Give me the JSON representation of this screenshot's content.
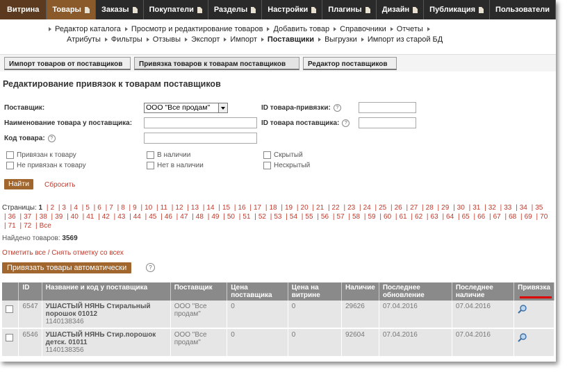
{
  "topnav": [
    {
      "label": "Витрина",
      "kind": "vitrina"
    },
    {
      "label": "Товары",
      "kind": "active"
    },
    {
      "label": "Заказы",
      "kind": "normal"
    },
    {
      "label": "Покупатели",
      "kind": "normal"
    },
    {
      "label": "Разделы",
      "kind": "normal"
    },
    {
      "label": "Настройки",
      "kind": "normal"
    },
    {
      "label": "Плагины",
      "kind": "normal"
    },
    {
      "label": "Дизайн",
      "kind": "normal"
    },
    {
      "label": "Публикация",
      "kind": "normal"
    },
    {
      "label": "Пользователи",
      "kind": "normal"
    }
  ],
  "submenu": {
    "row1": [
      "Редактор каталога",
      "Просмотр и редактирование товаров",
      "Добавить товар",
      "Справочники",
      "Отчеты"
    ],
    "row2": [
      "Атрибуты",
      "Фильтры",
      "Отзывы",
      "Экспорт",
      "Импорт",
      "Поставщики",
      "Выгрузки",
      "Импорт из старой БД"
    ],
    "active": "Поставщики"
  },
  "innertabs": [
    "Импорт товаров от поставщиков",
    "Привязка товаров к товарам поставщиков",
    "Редактор поставщиков"
  ],
  "page_title": "Редактирование привязок к товарам поставщиков",
  "form": {
    "supplier_label": "Поставщик:",
    "supplier_value": "ООО \"Все продам\"",
    "name_label": "Наименование товара у поставщика:",
    "code_label": "Код товара:",
    "link_id_label": "ID товара-привязки:",
    "supplier_id_label": "ID товара поставщика:",
    "help": "?",
    "checkboxes": [
      "Привязан к товару",
      "Не привязан к товару",
      "В наличии",
      "Нет в наличии",
      "Скрытый",
      "Нескрытый"
    ],
    "find_button": "Найти",
    "reset_link": "Сбросить"
  },
  "pages": {
    "label": "Страницы:",
    "current": "1",
    "items": [
      "2",
      "3",
      "4",
      "5",
      "6",
      "7",
      "8",
      "9",
      "10",
      "11",
      "12",
      "13",
      "14",
      "15",
      "16",
      "17",
      "18",
      "19",
      "20",
      "21",
      "22",
      "23",
      "24",
      "25",
      "26",
      "27",
      "28",
      "29",
      "30",
      "31",
      "32",
      "33",
      "34",
      "35",
      "36",
      "37",
      "38",
      "39",
      "40",
      "41",
      "42",
      "43",
      "44",
      "45",
      "46",
      "47",
      "48",
      "49",
      "50",
      "51",
      "52",
      "53",
      "54",
      "55",
      "56",
      "57",
      "58",
      "59",
      "60",
      "61",
      "62",
      "63",
      "64",
      "65",
      "66",
      "67",
      "68",
      "69",
      "70",
      "71",
      "72",
      "Все"
    ]
  },
  "found": {
    "label": "Найдено товаров:",
    "count": "3569"
  },
  "select_all": "Отметить все / Снять отметку со всех",
  "auto_button": "Привязать товары автоматически",
  "table": {
    "headers": [
      "ID",
      "Название и код у поставщика",
      "Поставщик",
      "Цена поставщика",
      "Цена на витрине",
      "Наличие",
      "Последнее обновление",
      "Последнее наличие",
      "Привязка"
    ],
    "rows": [
      {
        "id": "6547",
        "name": "УШАСТЫЙ НЯНЬ Стиральный порошок 01012",
        "code": "1140138346",
        "supplier": "ООО \"Все продам\"",
        "price_supplier": "0",
        "price_shop": "0",
        "stock": "29626",
        "updated": "07.04.2016",
        "last_stock": "07.04.2016"
      },
      {
        "id": "6546",
        "name": "УШАСТЫЙ НЯНЬ Стир.порошок детск. 01011",
        "code": "1140138356",
        "supplier": "ООО \"Все продам\"",
        "price_supplier": "0",
        "price_shop": "0",
        "stock": "92604",
        "updated": "07.04.2016",
        "last_stock": "07.04.2016"
      }
    ]
  },
  "colors": {
    "brand_dark": "#5b3a1f",
    "active_tab": "#8b5a2b",
    "button": "#a0662e",
    "link": "#c0392b",
    "header_bg": "#8a8a8a"
  }
}
